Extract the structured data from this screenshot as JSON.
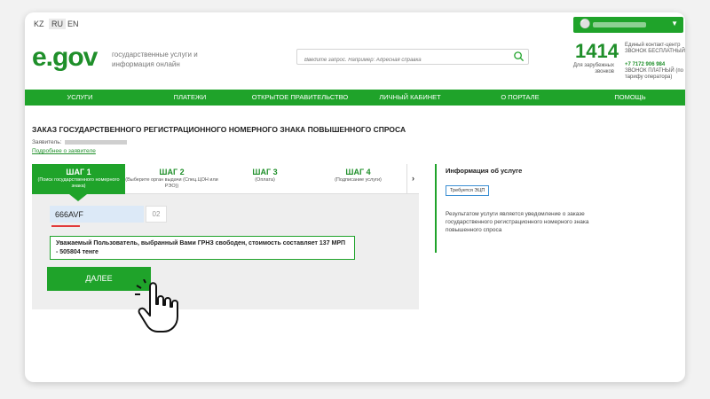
{
  "langs": [
    "KZ",
    "RU",
    "EN"
  ],
  "active_lang": "RU",
  "user": {
    "icon": "user-icon",
    "chevron": "chevron-down-icon"
  },
  "logo": {
    "text": "e.gov"
  },
  "tagline": "государственные услуги и информация онлайн",
  "search": {
    "placeholder": "Введите запрос. Например: Адресная справка"
  },
  "contact": {
    "phone": "1414",
    "line1": "Единый контакт-центр ЗВОНОК БЕСПЛАТНЫЙ",
    "abroad": "Для зарубежных звонков",
    "abroad_phone": "+7 7172 906 984",
    "abroad_note": "ЗВОНОК ПЛАТНЫЙ (по тарифу оператора)"
  },
  "nav": [
    "УСЛУГИ",
    "ПЛАТЕЖИ",
    "ОТКРЫТОЕ ПРАВИТЕЛЬСТВО",
    "ЛИЧНЫЙ КАБИНЕТ",
    "О ПОРТАЛЕ",
    "ПОМОЩЬ"
  ],
  "page_title": "ЗАКАЗ ГОСУДАРСТВЕННОГО РЕГИСТРАЦИОННОГО НОМЕРНОГО ЗНАКА ПОВЫШЕННОГО СПРОСА",
  "applicant_label": "Заявитель:",
  "edit_link": "Подробнее о заявителе",
  "steps": [
    {
      "title": "ШАГ 1",
      "sub": "(Поиск государственного номерного знака)"
    },
    {
      "title": "ШАГ 2",
      "sub": "(Выберите орган выдачи (Спец.ЦОН или РЭО))"
    },
    {
      "title": "ШАГ 3",
      "sub": "(Оплата)"
    },
    {
      "title": "ШАГ 4",
      "sub": "(Подписание услуги)"
    }
  ],
  "steps_next": "›",
  "plate": {
    "value": "666AVF",
    "region": "02"
  },
  "notice": "Уважаемый Пользователь, выбранный Вами ГРНЗ свободен, стоимость составляет 137 МРП - 505804 тенге",
  "next_button": "ДАЛЕЕ",
  "info": {
    "heading": "Информация об услуге",
    "badge": "Требуется ЭЦП",
    "text": "Результатом услуги является уведомление о заказе государственного регистрационного номерного знака повышенного спроса"
  },
  "colors": {
    "brand_green": "#1fa32a",
    "input_bg": "#dce9f7",
    "underline_red": "#e23a3a"
  }
}
